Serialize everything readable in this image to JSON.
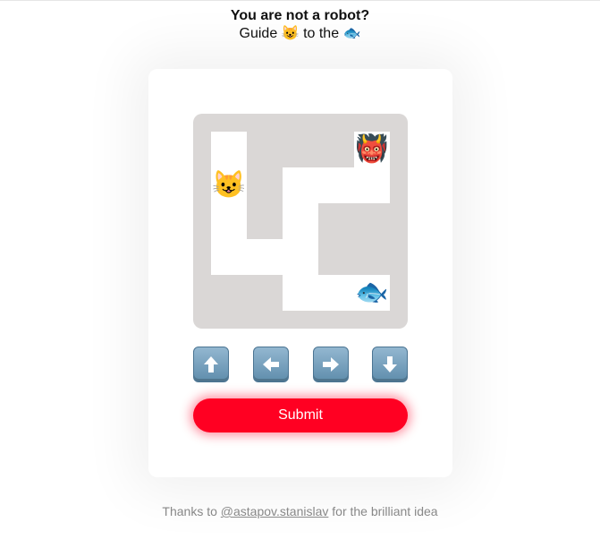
{
  "header": {
    "title": "You are not a robot?",
    "subtitle_prefix": "Guide",
    "cat_emoji": "😺",
    "subtitle_middle": "to the",
    "fish_emoji": "🐟"
  },
  "maze": {
    "tokens": {
      "cat": "😺",
      "ogre": "👹",
      "fish": "🐟"
    },
    "colors": {
      "wall": "#dad7d6",
      "path": "#ffffff"
    }
  },
  "controls": {
    "up_icon": "arrow-up-icon",
    "left_icon": "arrow-left-icon",
    "right_icon": "arrow-right-icon",
    "down_icon": "arrow-down-icon"
  },
  "submit": {
    "label": "Submit",
    "color": "#ff0022"
  },
  "footer": {
    "prefix": "Thanks to",
    "link_text": "@astapov.stanislav",
    "suffix": "for the brilliant idea"
  }
}
